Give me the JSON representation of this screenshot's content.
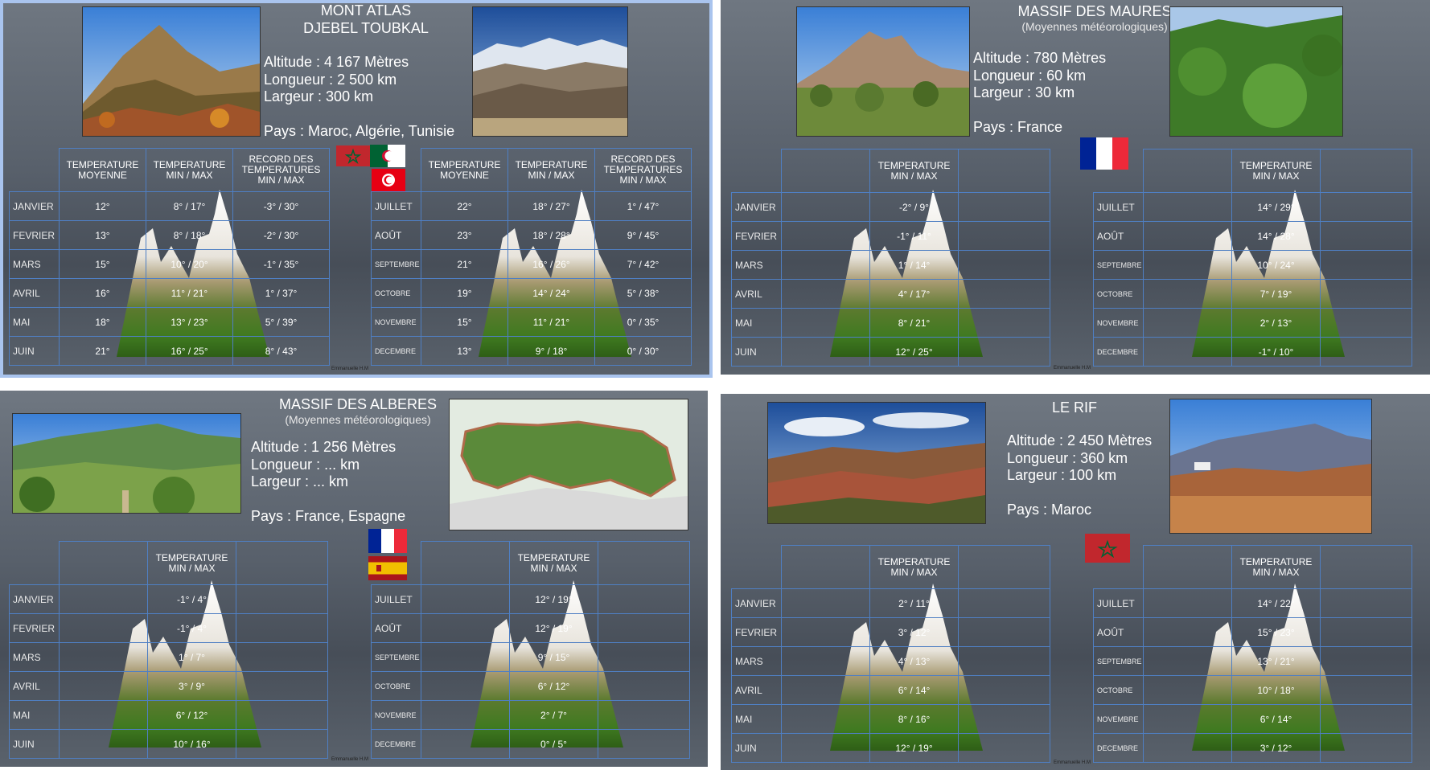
{
  "panels": [
    {
      "title_line1": "MONT ATLAS",
      "title_line2": "DJEBEL TOUBKAL",
      "info": [
        "Altitude : 4 167 Mètres",
        "Longueur : 2 500 km",
        "Largeur : 300 km"
      ],
      "country": "Pays : Maroc, Algérie, Tunisie",
      "headers": [
        "TEMPERATURE MOYENNE",
        "TEMPERATURE MIN / MAX",
        "RECORD DES TEMPERATURES MIN / MAX"
      ],
      "left_rows": [
        {
          "month": "JANVIER",
          "moy": "12°",
          "minmax": "8° / 17°",
          "record": "-3° / 30°"
        },
        {
          "month": "FEVRIER",
          "moy": "13°",
          "minmax": "8° / 18°",
          "record": "-2° / 30°"
        },
        {
          "month": "MARS",
          "moy": "15°",
          "minmax": "10° / 20°",
          "record": "-1° / 35°"
        },
        {
          "month": "AVRIL",
          "moy": "16°",
          "minmax": "11° / 21°",
          "record": "1° / 37°"
        },
        {
          "month": "MAI",
          "moy": "18°",
          "minmax": "13° / 23°",
          "record": "5° / 39°"
        },
        {
          "month": "JUIN",
          "moy": "21°",
          "minmax": "16° / 25°",
          "record": "8° / 43°"
        }
      ],
      "right_rows": [
        {
          "month": "JUILLET",
          "moy": "22°",
          "minmax": "18° / 27°",
          "record": "1° / 47°"
        },
        {
          "month": "AOÛT",
          "moy": "23°",
          "minmax": "18° / 28°",
          "record": "9° / 45°"
        },
        {
          "month": "SEPTEMBRE",
          "moy": "21°",
          "minmax": "16° / 26°",
          "record": "7° / 42°"
        },
        {
          "month": "OCTOBRE",
          "moy": "19°",
          "minmax": "14° / 24°",
          "record": "5° / 38°"
        },
        {
          "month": "NOVEMBRE",
          "moy": "15°",
          "minmax": "11° / 21°",
          "record": "0° / 35°"
        },
        {
          "month": "DECEMBRE",
          "moy": "13°",
          "minmax": "9° / 18°",
          "record": "0° / 30°"
        }
      ],
      "credit": "Emmanuelle H.M"
    },
    {
      "title_line1": "MASSIF DES MAURES",
      "subtitle": "(Moyennes météorologiques)",
      "info": [
        "Altitude : 780 Mètres",
        "Longueur : 60 km",
        "Largeur : 30 km"
      ],
      "country": "Pays : France",
      "header": "TEMPERATURE MIN / MAX",
      "left_rows": [
        {
          "month": "JANVIER",
          "minmax": "-2° / 9°"
        },
        {
          "month": "FEVRIER",
          "minmax": "-1° / 11°"
        },
        {
          "month": "MARS",
          "minmax": "1° / 14°"
        },
        {
          "month": "AVRIL",
          "minmax": "4° / 17°"
        },
        {
          "month": "MAI",
          "minmax": "8° / 21°"
        },
        {
          "month": "JUIN",
          "minmax": "12° / 25°"
        }
      ],
      "right_rows": [
        {
          "month": "JUILLET",
          "minmax": "14° / 29°"
        },
        {
          "month": "AOÛT",
          "minmax": "14° / 28°"
        },
        {
          "month": "SEPTEMBRE",
          "minmax": "10° / 24°"
        },
        {
          "month": "OCTOBRE",
          "minmax": "7° / 19°"
        },
        {
          "month": "NOVEMBRE",
          "minmax": "2° / 13°"
        },
        {
          "month": "DECEMBRE",
          "minmax": "-1° / 10°"
        }
      ],
      "credit": "Emmanuelle H.M"
    },
    {
      "title_line1": "MASSIF DES ALBERES",
      "subtitle": "(Moyennes météorologiques)",
      "info": [
        "Altitude : 1 256 Mètres",
        "Longueur : ... km",
        "Largeur : ... km"
      ],
      "country": "Pays : France, Espagne",
      "header": "TEMPERATURE MIN / MAX",
      "left_rows": [
        {
          "month": "JANVIER",
          "minmax": "-1° / 4°"
        },
        {
          "month": "FEVRIER",
          "minmax": "-1° / 4°"
        },
        {
          "month": "MARS",
          "minmax": "1° / 7°"
        },
        {
          "month": "AVRIL",
          "minmax": "3° / 9°"
        },
        {
          "month": "MAI",
          "minmax": "6° / 12°"
        },
        {
          "month": "JUIN",
          "minmax": "10° / 16°"
        }
      ],
      "right_rows": [
        {
          "month": "JUILLET",
          "minmax": "12° / 19°"
        },
        {
          "month": "AOÛT",
          "minmax": "12° / 19°"
        },
        {
          "month": "SEPTEMBRE",
          "minmax": "9° / 15°"
        },
        {
          "month": "OCTOBRE",
          "minmax": "6° / 12°"
        },
        {
          "month": "NOVEMBRE",
          "minmax": "2° / 7°"
        },
        {
          "month": "DECEMBRE",
          "minmax": "0° / 5°"
        }
      ],
      "credit": "Emmanuelle H.M"
    },
    {
      "title_line1": "LE RIF",
      "info": [
        "Altitude : 2 450 Mètres",
        "Longueur : 360 km",
        "Largeur : 100 km"
      ],
      "country": "Pays : Maroc",
      "header": "TEMPERATURE MIN / MAX",
      "left_rows": [
        {
          "month": "JANVIER",
          "minmax": "2° / 11°"
        },
        {
          "month": "FEVRIER",
          "minmax": "3° / 12°"
        },
        {
          "month": "MARS",
          "minmax": "4° / 13°"
        },
        {
          "month": "AVRIL",
          "minmax": "6° / 14°"
        },
        {
          "month": "MAI",
          "minmax": "8° / 16°"
        },
        {
          "month": "JUIN",
          "minmax": "12° / 19°"
        }
      ],
      "right_rows": [
        {
          "month": "JUILLET",
          "minmax": "14° / 22°"
        },
        {
          "month": "AOÛT",
          "minmax": "15° / 23°"
        },
        {
          "month": "SEPTEMBRE",
          "minmax": "13° / 21°"
        },
        {
          "month": "OCTOBRE",
          "minmax": "10° / 18°"
        },
        {
          "month": "NOVEMBRE",
          "minmax": "6° / 14°"
        },
        {
          "month": "DECEMBRE",
          "minmax": "3° / 12°"
        }
      ],
      "credit": "Emmanuelle H.M"
    }
  ],
  "colors": {
    "grid_line": "#4f7fc3",
    "panel_bg": "#5a626c",
    "selection": "#a9c4ee"
  }
}
